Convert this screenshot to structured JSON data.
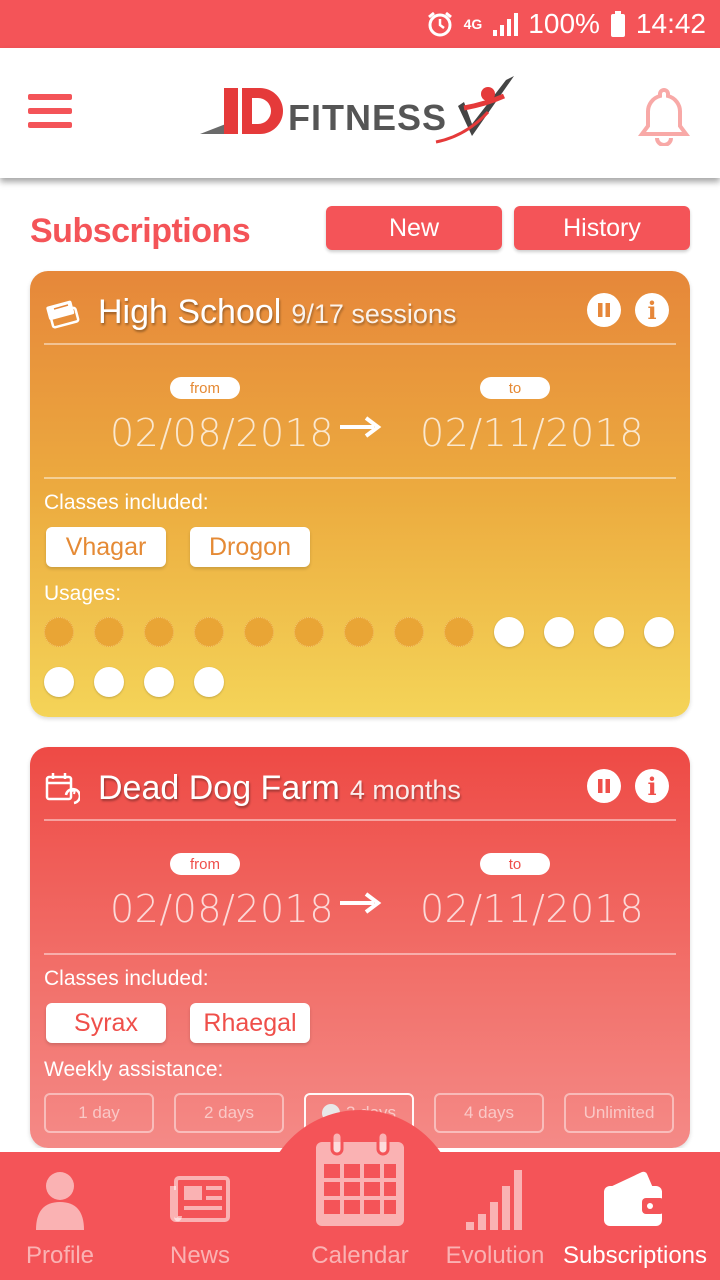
{
  "status_bar": {
    "network": "4G",
    "battery": "100%",
    "time": "14:42"
  },
  "header": {
    "logo_letters": "D",
    "logo_text": "FITNESS"
  },
  "page": {
    "title": "Subscriptions",
    "new_label": "New",
    "history_label": "History"
  },
  "subscriptions": [
    {
      "title": "High School",
      "subtitle": "9/17 sessions",
      "from_label": "from",
      "to_label": "to",
      "from_date": "02/08/2018",
      "to_date": "02/11/2018",
      "classes_label": "Classes included:",
      "classes": [
        "Vhagar",
        "Drogon"
      ],
      "usages_label": "Usages:",
      "usages_used": 9,
      "usages_total": 17,
      "accent": "#e5932e"
    },
    {
      "title": "Dead Dog Farm",
      "subtitle": "4 months",
      "from_label": "from",
      "to_label": "to",
      "from_date": "02/08/2018",
      "to_date": "02/11/2018",
      "classes_label": "Classes included:",
      "classes": [
        "Syrax",
        "Rhaegal"
      ],
      "weekly_label": "Weekly assistance:",
      "weekly_options": [
        "1 day",
        "2 days",
        "3 days",
        "4 days",
        "Unlimited"
      ],
      "weekly_selected": "3 days",
      "accent": "#ef4f4a"
    }
  ],
  "nav": [
    {
      "label": "Profile",
      "active": false
    },
    {
      "label": "News",
      "active": false
    },
    {
      "label": "Calendar",
      "active": false
    },
    {
      "label": "Evolution",
      "active": false
    },
    {
      "label": "Subscriptions",
      "active": true
    }
  ],
  "colors": {
    "brand": "#f45458"
  }
}
